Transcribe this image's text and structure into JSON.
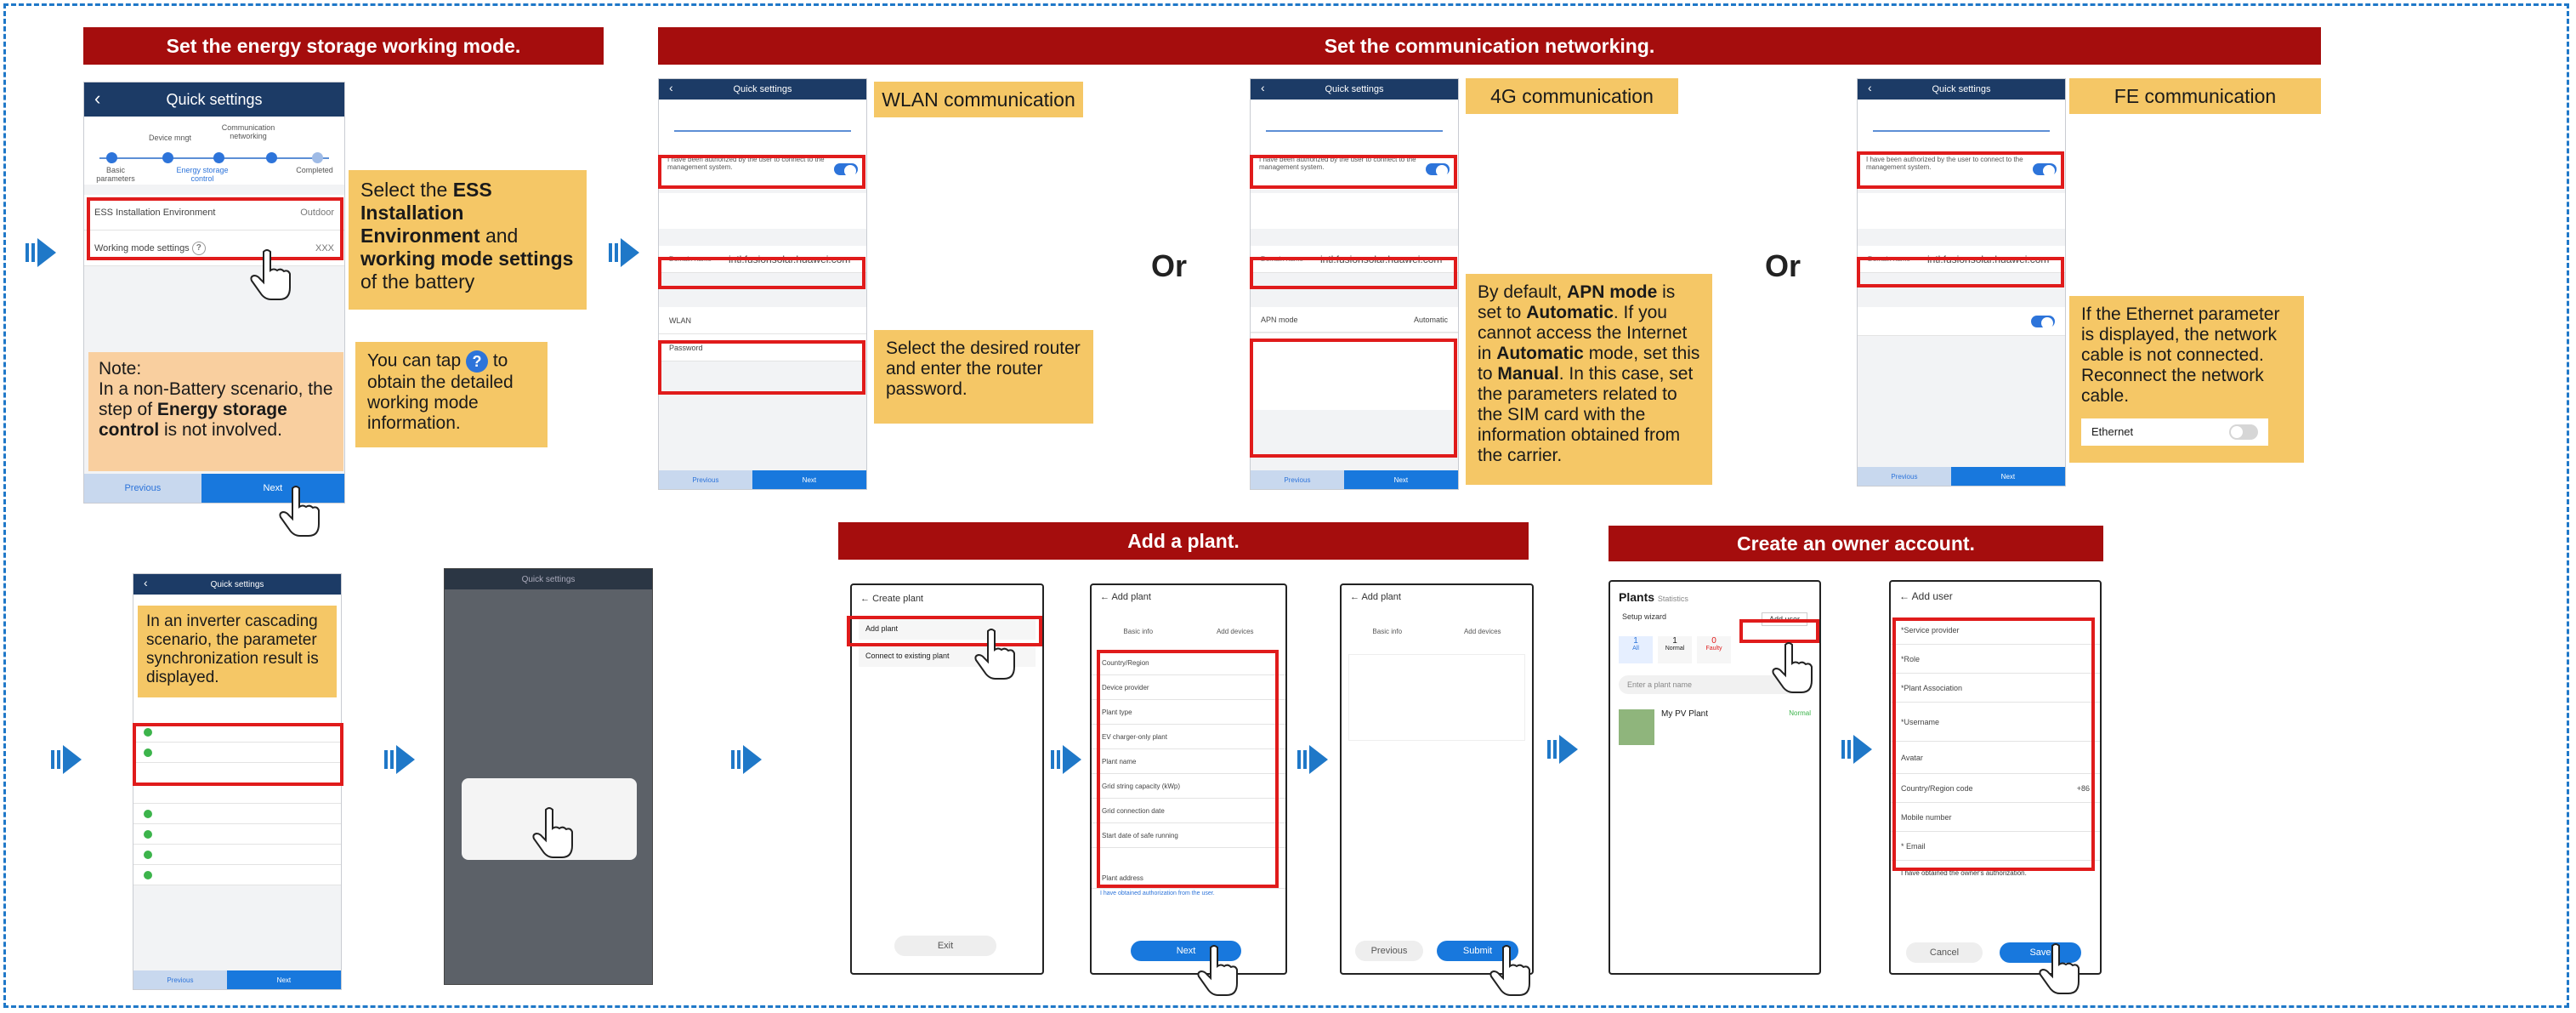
{
  "bands": {
    "mode": "Set the energy storage working mode.",
    "network": "Set the communication networking.",
    "plant": "Add a plant.",
    "owner": "Create an owner account."
  },
  "quick": {
    "title": "Quick settings",
    "steps": [
      "Device mngt",
      "Communication networking",
      "Basic parameters",
      "Energy storage control",
      "Completed"
    ],
    "ess_label": "ESS Installation Environment",
    "ess_value": "Outdoor",
    "mode_label": "Working mode settings",
    "mode_value": "XXX",
    "previous": "Previous",
    "next": "Next"
  },
  "notes": {
    "ess_a": "Select the ",
    "ess_b": "ESS Installation Environment",
    "ess_c": " and ",
    "ess_d": "working mode settings",
    "ess_e": " of the battery",
    "tap_a": "You can tap ",
    "tap_icon": "?",
    "tap_b": " to obtain the detailed working mode information.",
    "nb_title": "Note:",
    "nb_a": "In a non-Battery scenario, the step of ",
    "nb_b": "Energy storage control",
    "nb_c": " is not involved.",
    "cascade": "In an inverter cascading scenario, the parameter synchronization result is displayed.",
    "wlan_tag": "WLAN communication",
    "g4_tag": "4G communication",
    "fe_tag": "FE communication",
    "wlan_note": "Select the desired router and enter the router password.",
    "apn_a": "By default, ",
    "apn_b": "APN mode",
    "apn_c": " is set to ",
    "apn_d": "Automatic",
    "apn_e": ". If you cannot access the Internet in ",
    "apn_f": "Automatic",
    "apn_g": " mode, set this to ",
    "apn_h": "Manual",
    "apn_i": ". In this case, set the parameters related to the SIM card with the information obtained from the carrier.",
    "fe_note": "If the Ethernet parameter is displayed, the network cable is not connected. Reconnect the network cable.",
    "ethernet": "Ethernet"
  },
  "or": "Or",
  "network": {
    "domain_label": "Domain name",
    "domain": "intl.fusionsolar.huawei.com",
    "wlan": "WLAN",
    "password": "Password",
    "apn": "APN mode",
    "apn_value": "Automatic",
    "auth": "I have been authorized by the user to connect to the management system."
  },
  "create_plant": {
    "title": "Create plant",
    "add": "Add plant",
    "connect": "Connect to existing plant",
    "exit": "Exit"
  },
  "add_plant": {
    "title": "Add plant",
    "tabs": [
      "Basic info",
      "Add devices"
    ],
    "fields": [
      "Country/Region",
      "Device provider",
      "Plant type",
      "EV charger-only plant",
      "Plant name",
      "Grid string capacity (kWp)",
      "Grid connection date",
      "Start date of safe running"
    ],
    "address": "Plant address",
    "consent": "I have obtained authorization from the user.",
    "next": "Next",
    "previous": "Previous",
    "submit": "Submit"
  },
  "plants": {
    "title": "Plants",
    "stats": "Statistics",
    "setup": "Setup wizard",
    "adduser": "Add user",
    "counts": [
      "1",
      "1",
      "0"
    ],
    "count_labels": [
      "All",
      "Normal",
      "Faulty"
    ],
    "search": "Enter a plant name",
    "plant_name": "My PV Plant",
    "plant_status": "Normal"
  },
  "add_user": {
    "title": "Add user",
    "fields": [
      "*Service provider",
      "*Role",
      "*Plant Association",
      "*Username",
      "Avatar",
      "Country/Region code",
      "Mobile number",
      "* Email"
    ],
    "cc": "+86",
    "consent": "I have obtained the owner's authorization.",
    "cancel": "Cancel",
    "save": "Save"
  },
  "colors": {
    "band": "#a50d0d",
    "note": "#f5c766",
    "accent": "#1f78c8",
    "highlight": "#e01b1b"
  }
}
